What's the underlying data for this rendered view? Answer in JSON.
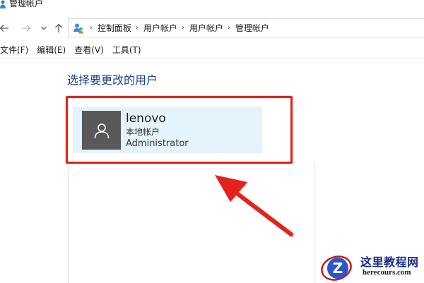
{
  "window": {
    "title": "管理帐户"
  },
  "nav": {
    "back_icon": "arrow-left-icon",
    "forward_icon": "arrow-right-icon",
    "recent_icon": "chevron-down-icon",
    "up_icon": "arrow-up-icon",
    "breadcrumb": [
      "控制面板",
      "用户帐户",
      "用户帐户",
      "管理帐户"
    ]
  },
  "menu": {
    "items": [
      "文件(F)",
      "编辑(E)",
      "查看(V)",
      "工具(T)"
    ]
  },
  "main": {
    "heading": "选择要更改的用户",
    "account": {
      "name": "lenovo",
      "type": "本地帐户",
      "role": "Administrator",
      "avatar_icon": "user-silhouette-icon"
    }
  },
  "annotation": {
    "color": "#e3231e"
  },
  "watermark": {
    "title": "这里教程网",
    "url": "herecours.com",
    "logo_icon": "z-logo-icon",
    "title_color": "#1a2b8c"
  }
}
